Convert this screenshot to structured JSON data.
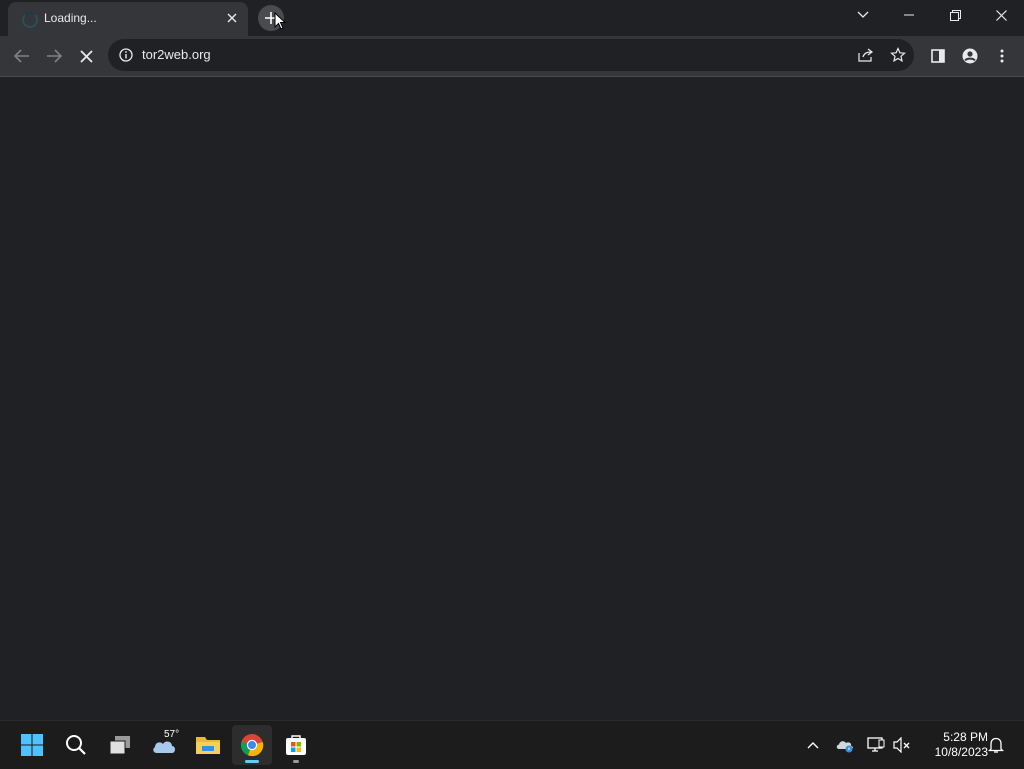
{
  "browser": {
    "tab": {
      "title": "Loading...",
      "close_icon": "close-icon"
    },
    "new_tab_icon": "plus-icon",
    "window_controls": [
      "chevron-down-icon",
      "minimize-icon",
      "restore-icon",
      "close-icon"
    ],
    "toolbar": {
      "back_icon": "arrow-left-icon",
      "forward_icon": "arrow-right-icon",
      "stop_icon": "close-icon",
      "url": "tor2web.org",
      "site_info_icon": "info-icon",
      "share_icon": "share-icon",
      "bookmark_icon": "star-icon",
      "side_panel_icon": "side-panel-icon",
      "profile_icon": "person-icon",
      "menu_icon": "kebab-menu-icon"
    },
    "colors": {
      "background": "#202124",
      "toolbar": "#35363a",
      "text": "#e8eaed"
    }
  },
  "taskbar": {
    "weather_temp": "57°",
    "apps": [
      "windows-start-icon",
      "search-icon",
      "task-view-icon",
      "weather-icon",
      "file-explorer-icon",
      "chrome-icon",
      "store-icon"
    ],
    "tray": [
      "chevron-up-icon",
      "onedrive-icon",
      "network-icon",
      "volume-muted-icon",
      "notification-bell-icon"
    ],
    "clock": {
      "time": "5:28 PM",
      "date": "10/8/2023"
    },
    "colors": {
      "background": "#1c1c1c",
      "accent": "#60cdff"
    }
  }
}
